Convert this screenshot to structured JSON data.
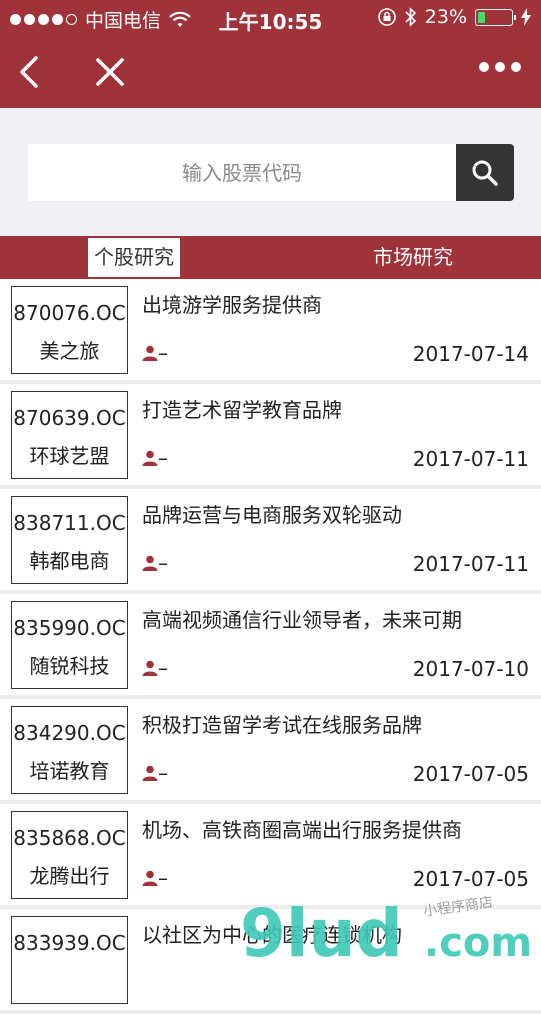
{
  "status_bar": {
    "carrier": "中国电信",
    "time": "上午10:55",
    "battery_percent": "23%",
    "battery_level": 0.23,
    "colors": {
      "bar": "#a0323a",
      "battery_fill": "#4cd964"
    }
  },
  "navbar": {
    "back_icon": "chevron-left-icon",
    "close_icon": "close-icon",
    "more_icon": "more-dots-icon"
  },
  "search": {
    "placeholder": "输入股票代码",
    "button_icon": "search-icon"
  },
  "tabs": {
    "stock_research": "个股研究",
    "market_research": "市场研究",
    "active": "stock_research"
  },
  "reports": [
    {
      "code": "870076.OC",
      "name": "美之旅",
      "title": "出境游学服务提供商",
      "author": "–",
      "date": "2017-07-14"
    },
    {
      "code": "870639.OC",
      "name": "环球艺盟",
      "title": "打造艺术留学教育品牌",
      "author": "–",
      "date": "2017-07-11"
    },
    {
      "code": "838711.OC",
      "name": "韩都电商",
      "title": "品牌运营与电商服务双轮驱动",
      "author": "–",
      "date": "2017-07-11"
    },
    {
      "code": "835990.OC",
      "name": "随锐科技",
      "title": "高端视频通信行业领导者，未来可期",
      "author": "–",
      "date": "2017-07-10"
    },
    {
      "code": "834290.OC",
      "name": "培诺教育",
      "title": "积极打造留学考试在线服务品牌",
      "author": "–",
      "date": "2017-07-05"
    },
    {
      "code": "835868.OC",
      "name": "龙腾出行",
      "title": "机场、高铁商圈高端出行服务提供商",
      "author": "–",
      "date": "2017-07-05"
    },
    {
      "code": "833939.OC",
      "name": "",
      "title": "以社区为中心的医疗连锁机构",
      "author": "",
      "date": ""
    }
  ],
  "watermark": {
    "text": "9lud.com",
    "subtext": "小程序商店"
  }
}
